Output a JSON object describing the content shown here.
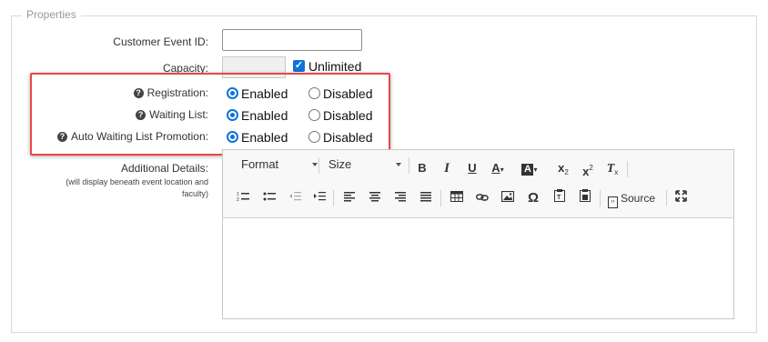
{
  "properties": {
    "legend": "Properties",
    "customer_event_id": {
      "label": "Customer Event ID:",
      "value": ""
    },
    "capacity": {
      "label": "Capacity:",
      "value": "",
      "unlimited_label": "Unlimited",
      "unlimited_checked": true
    },
    "registration": {
      "label": "Registration:",
      "enabled_label": "Enabled",
      "disabled_label": "Disabled",
      "selected": "Enabled"
    },
    "waiting_list": {
      "label": "Waiting List:",
      "enabled_label": "Enabled",
      "disabled_label": "Disabled",
      "selected": "Enabled"
    },
    "auto_promotion": {
      "label": "Auto Waiting List Promotion:",
      "enabled_label": "Enabled",
      "disabled_label": "Disabled",
      "selected": "Enabled"
    },
    "additional_details": {
      "label": "Additional Details:",
      "sublabel_line1": "(will display beneath event location and",
      "sublabel_line2": "faculty)"
    }
  },
  "editor": {
    "format_label": "Format",
    "size_label": "Size",
    "source_label": "Source",
    "content": ""
  },
  "colors": {
    "accent": "#0b74d8",
    "highlight_border": "#e8474a"
  }
}
